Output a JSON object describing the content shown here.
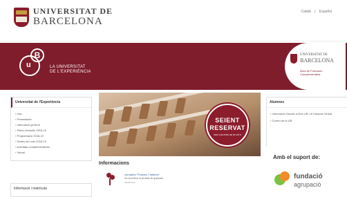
{
  "header": {
    "logo_line1": "UNIVERSITAT DE",
    "logo_line2": "BARCELONA",
    "languages": [
      "Català",
      "Español"
    ]
  },
  "banner": {
    "logo_letters": "UB",
    "title_line1": "LA UNIVERSITAT",
    "title_line2": "DE L'EXPERIÈNCIA",
    "right_logo_line1": "UNIVERSITAT DE",
    "right_logo_line2": "BARCELONA",
    "right_sub_line1": "Àrea de Formació",
    "right_sub_line2": "Complementària"
  },
  "sidebar": {
    "title": "Universitat de l'Experiència",
    "items": [
      "Inici",
      "Presentació",
      "Informació general",
      "Plans d'estudis 2018-19",
      "Programació 2018-19",
      "Dades del curs 2018-19",
      "Activitats complementàries",
      "Virtual"
    ]
  },
  "sidebar2": {
    "title": "Informació i matrícula"
  },
  "hero": {
    "badge_line1": "SEIENT",
    "badge_line2": "RESERVAT",
    "badge_line3": "PER A MAJORS DE 50 ANYS"
  },
  "informacions": {
    "title": "Informacions",
    "items": [
      {
        "title": "Jornades \"Policies i Talleres\"",
        "desc": "Us recordem la jornada de graduats.",
        "date": "06/06/2018"
      }
    ]
  },
  "alumnes": {
    "title": "Alumnes",
    "items": [
      "Informació d'accés a Món UB i al Campus Virtual",
      "Correu de la UB"
    ]
  },
  "support": {
    "title": "Amb el suport de:",
    "org_line1": "fundació",
    "org_line2": "agrupació"
  },
  "colors": {
    "brand": "#7f1d2c",
    "accent_green": "#7cc242",
    "accent_orange": "#f28c28"
  }
}
